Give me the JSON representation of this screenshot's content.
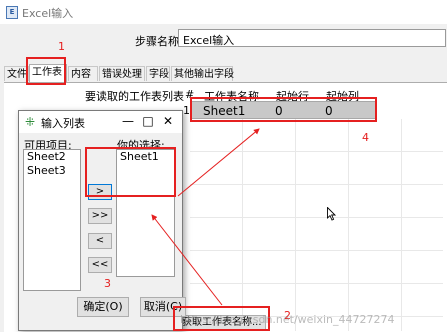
{
  "window": {
    "title": "Excel输入",
    "icon": "excel-input-app-icon"
  },
  "step_name": {
    "label": "步骤名称",
    "value": "Excel输入"
  },
  "tabs": [
    {
      "label": "文件",
      "active": false
    },
    {
      "label": "工作表",
      "active": true
    },
    {
      "label": "内容",
      "active": false
    },
    {
      "label": "错误处理",
      "active": false
    },
    {
      "label": "字段",
      "active": false
    },
    {
      "label": "其他输出字段",
      "active": false
    }
  ],
  "sheets_label": "要读取的工作表列表",
  "grid": {
    "headers": [
      "#",
      "工作表名称",
      "起始行",
      "起始列"
    ],
    "rows": [
      {
        "num": "1",
        "name": "Sheet1",
        "start_row": "0",
        "start_col": "0"
      }
    ]
  },
  "get_sheets_button": "获取工作表名称...",
  "dialog": {
    "title": "输入列表",
    "icon": "list-input-icon",
    "controls": {
      "minimize": "—",
      "maximize": "□",
      "close": "✕"
    },
    "available_label": "可用项目:",
    "available_items": [
      "Sheet2",
      "Sheet3"
    ],
    "chosen_label": "你的选择:",
    "chosen_items": [
      "Sheet1"
    ],
    "move_buttons": [
      ">",
      ">>",
      "<",
      "<<"
    ],
    "ok_label": "确定(O)",
    "cancel_label": "取消(C)"
  },
  "annotations": [
    "1",
    "2",
    "3",
    "4"
  ],
  "annotation_color": "#e52020",
  "watermark": "https://blog.csdn.net/weixin_44727274"
}
